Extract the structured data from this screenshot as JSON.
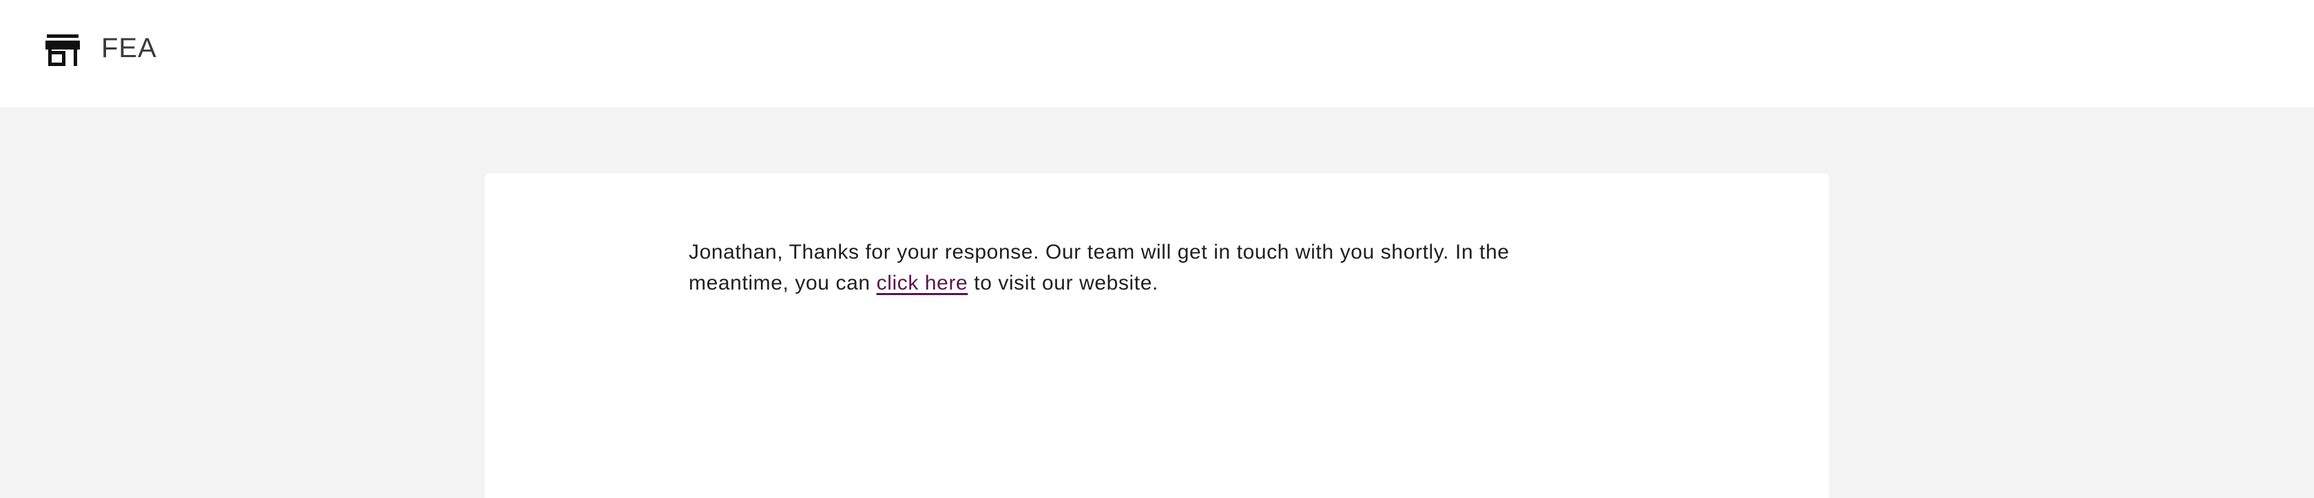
{
  "header": {
    "logo_icon": "store-icon",
    "brand": "FEA"
  },
  "message": {
    "before_link": "Jonathan, Thanks for your response. Our team will get in touch with you shortly. In the meantime, you can ",
    "link_text": "click here",
    "after_link": " to visit our website."
  },
  "colors": {
    "page_background": "#f3f3f3",
    "card_background": "#ffffff",
    "link": "#5a1450",
    "text": "#1f1f1f"
  }
}
